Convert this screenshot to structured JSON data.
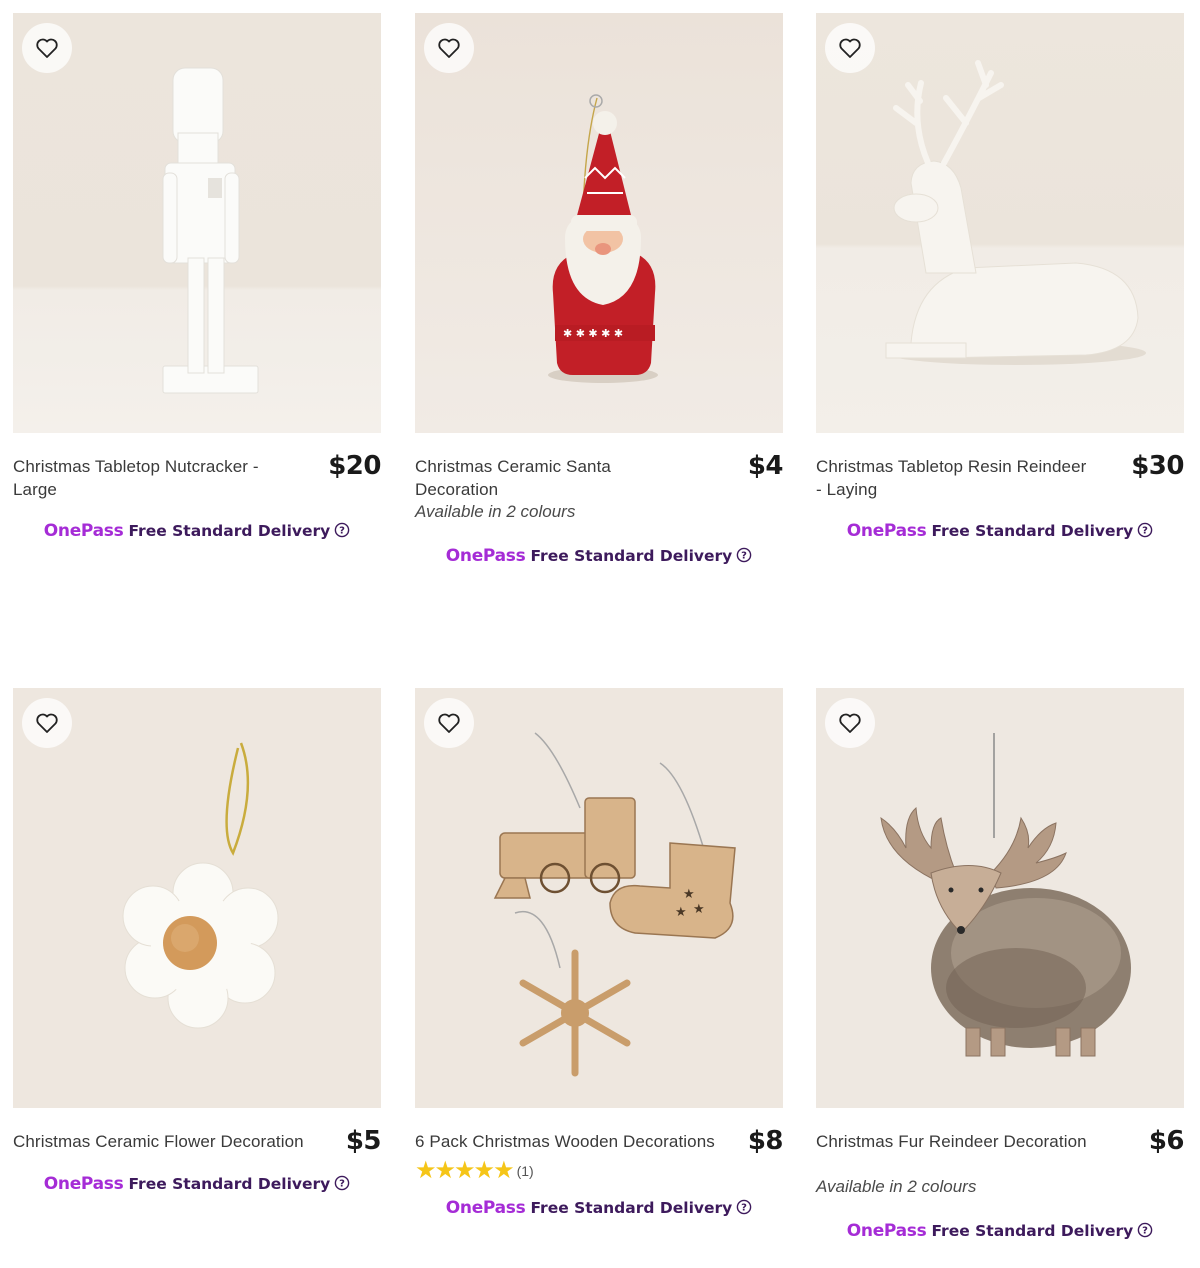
{
  "products": [
    {
      "title": "Christmas Tabletop Nutcracker - Large",
      "price": "$20",
      "colours": "",
      "image_alt": "white nutcracker figure"
    },
    {
      "title": "Christmas Ceramic Santa Decoration",
      "price": "$4",
      "colours": "Available in 2 colours",
      "image_alt": "red ceramic santa ornament"
    },
    {
      "title": "Christmas Tabletop Resin Reindeer - Laying",
      "price": "$30",
      "colours": "",
      "image_alt": "white resin reindeer"
    },
    {
      "title": "Christmas Ceramic Flower Decoration",
      "price": "$5",
      "colours": "",
      "image_alt": "white ceramic flower ornament"
    },
    {
      "title": "6 Pack Christmas Wooden Decorations",
      "price": "$8",
      "colours": "",
      "rating_count": "(1)",
      "rating_value": 5,
      "image_alt": "wooden train stocking and snowflake ornaments"
    },
    {
      "title": "Christmas Fur Reindeer Decoration",
      "price": "$6",
      "colours": "Available in 2 colours",
      "image_alt": "fur reindeer ornament"
    }
  ],
  "onepass": {
    "logo": "OnePass",
    "text": "Free Standard Delivery"
  },
  "colors": {
    "onepass_logo": "#a52cd6",
    "onepass_text": "#3d1a5c",
    "star": "#f5c518",
    "image_bg": "#efe9e3"
  },
  "icons": {
    "wishlist": "heart-outline-icon",
    "help": "question-circle-icon",
    "rating": "star-icon"
  }
}
